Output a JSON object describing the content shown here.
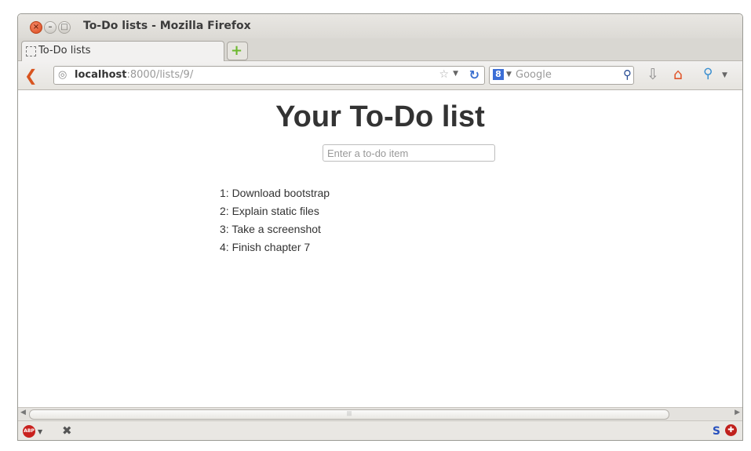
{
  "window": {
    "title": "To-Do lists - Mozilla Firefox",
    "close_glyph": "×",
    "minimize_glyph": "–",
    "maximize_glyph": "□"
  },
  "tabs": [
    {
      "label": "To-Do lists",
      "active": true
    }
  ],
  "toolbar": {
    "url_host": "localhost",
    "url_rest": ":8000/lists/9/",
    "search_engine": "Google",
    "search_placeholder": "Google"
  },
  "page": {
    "heading": "Your To-Do list",
    "input_placeholder": "Enter a to-do item",
    "items": [
      "1: Download bootstrap",
      "2: Explain static files",
      "3: Take a screenshot",
      "4: Finish chapter 7"
    ]
  },
  "addon_bar": {
    "abp_label": "ABP"
  },
  "icons": {
    "back": "back-arrow-icon",
    "globe": "globe-icon",
    "star": "bookmark-star-icon",
    "reload": "reload-icon",
    "search": "magnifier-icon",
    "download": "download-arrow-icon",
    "home": "home-icon",
    "network": "network-icon"
  },
  "colors": {
    "back_arrow": "#d8541f",
    "reload": "#3a6fd0",
    "home": "#e0552a",
    "new_tab_plus": "#6cb82e"
  }
}
